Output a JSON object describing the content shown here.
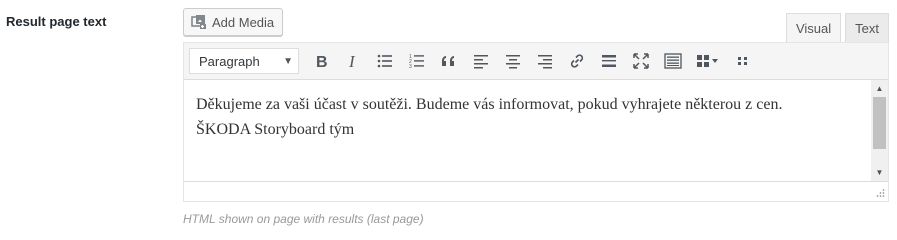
{
  "field": {
    "label": "Result page text",
    "help": "HTML shown on page with results (last page)"
  },
  "media": {
    "add_label": "Add Media",
    "icon": "add-media-icon"
  },
  "tabs": [
    {
      "label": "Visual",
      "active": true
    },
    {
      "label": "Text",
      "active": false
    }
  ],
  "toolbar": {
    "format_value": "Paragraph",
    "buttons": [
      "bold-icon",
      "italic-icon",
      "bullet-list-icon",
      "numbered-list-icon",
      "blockquote-icon",
      "align-left-icon",
      "align-center-icon",
      "align-right-icon",
      "link-icon",
      "read-more-icon",
      "fullscreen-icon",
      "toolbar-toggle-icon",
      "shortcodes-icon",
      "drag-handle-icon"
    ]
  },
  "content": {
    "paragraphs": [
      "Děkujeme za vaši účast v soutěži. Budeme vás informovat, pokud vyhrajete některou z cen.",
      "ŠKODA Storyboard tým"
    ]
  },
  "colors": {
    "border": "#dddddd",
    "toolbar_bg": "#f5f5f5",
    "help_text": "#999999"
  }
}
